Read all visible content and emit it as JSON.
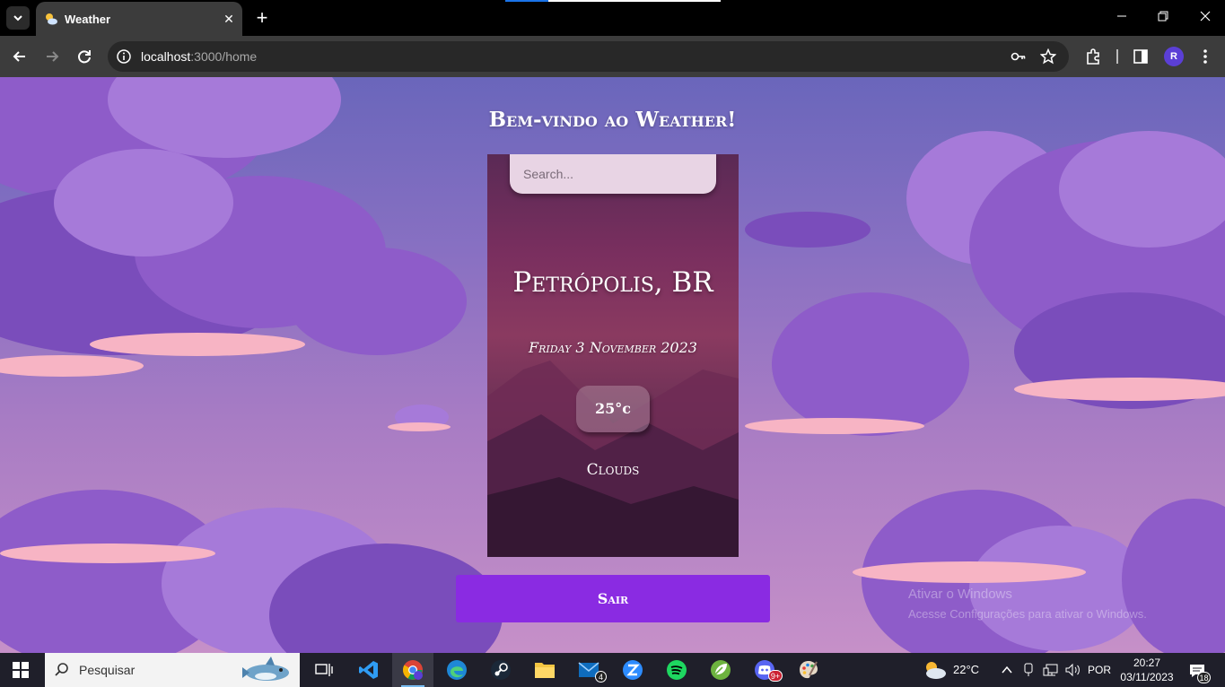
{
  "browser": {
    "tab_title": "Weather",
    "url_host": "localhost",
    "url_rest": ":3000/home",
    "new_tab_symbol": "+",
    "close_tab_symbol": "✕",
    "profile_initial": "R"
  },
  "page": {
    "welcome": "Bem-vindo ao Weather!",
    "search_placeholder": "Search...",
    "city": "Petrópolis, BR",
    "date": "Friday 3 November 2023",
    "temperature": "25°c",
    "condition": "Clouds",
    "logout_label": "Sair",
    "watermark_line1": "Ativar o Windows",
    "watermark_line2": "Acesse Configurações para ativar o Windows."
  },
  "taskbar": {
    "search_placeholder": "Pesquisar",
    "weather_temp": "22°C",
    "language": "POR",
    "time": "20:27",
    "date": "03/11/2023",
    "mail_badge": "4",
    "discord_badge": "9+",
    "notification_count": "18"
  },
  "colors": {
    "accent_button": "#8a2be2",
    "sky_top": "#6a66bb",
    "sky_bottom": "#c690c8"
  }
}
